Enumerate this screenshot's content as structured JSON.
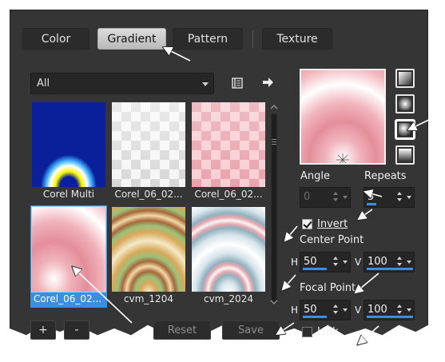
{
  "tabs": [
    {
      "label": "Color",
      "active": false
    },
    {
      "label": "Gradient",
      "active": true
    },
    {
      "label": "Pattern",
      "active": false
    },
    {
      "label": "Texture",
      "active": false
    }
  ],
  "category": {
    "value": "All"
  },
  "thumbnails": [
    {
      "caption": "Corel Multi",
      "selected": false
    },
    {
      "caption": "Corel_06_02...",
      "selected": false
    },
    {
      "caption": "Corel_06_02...",
      "selected": false
    },
    {
      "caption": "Corel_06_02...",
      "selected": true
    },
    {
      "caption": "cvm_1204",
      "selected": false
    },
    {
      "caption": "cvm_2024",
      "selected": false
    }
  ],
  "buttons": {
    "add": "+",
    "remove": "-",
    "reset": "Reset",
    "save": "Save"
  },
  "angle": {
    "label": "Angle",
    "value": "0",
    "enabled": false
  },
  "repeats": {
    "label": "Repeats",
    "value": "5"
  },
  "invert": {
    "label": "Invert",
    "checked": true
  },
  "center_point": {
    "label": "Center Point",
    "h_label": "H",
    "h": "50",
    "v_label": "V",
    "v": "100"
  },
  "focal_point": {
    "label": "Focal Point",
    "h_label": "H",
    "h": "50",
    "v_label": "V",
    "v": "100"
  },
  "link": {
    "label": "Link",
    "checked": false
  },
  "gradient_styles": [
    "linear",
    "rectangular",
    "sunburst",
    "radial"
  ],
  "selected_style": "sunburst",
  "icons": {
    "library": "library-book-icon",
    "export": "arrow-right-icon"
  },
  "colors": {
    "panel": "#353535",
    "accent": "#3b8fe0",
    "pink": "#e89aa4"
  }
}
